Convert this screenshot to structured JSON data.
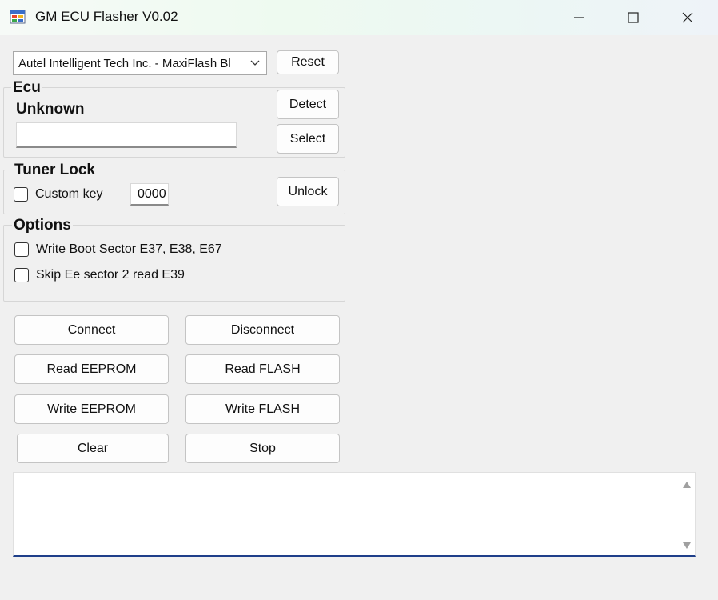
{
  "window": {
    "title": "GM ECU Flasher V0.02"
  },
  "device": {
    "selected": "Autel Intelligent Tech Inc. - MaxiFlash Bl",
    "reset_label": "Reset"
  },
  "ecu": {
    "group_title": "Ecu",
    "status": "Unknown",
    "input_value": "",
    "detect_label": "Detect",
    "select_label": "Select"
  },
  "tuner_lock": {
    "group_title": "Tuner Lock",
    "custom_key_label": "Custom key",
    "key_value": "0000",
    "unlock_label": "Unlock"
  },
  "options": {
    "group_title": "Options",
    "items": [
      {
        "label": "Write Boot Sector E37, E38, E67",
        "checked": false
      },
      {
        "label": "Skip Ee sector 2 read E39",
        "checked": false
      }
    ]
  },
  "actions": {
    "connect": "Connect",
    "disconnect": "Disconnect",
    "read_eeprom": "Read  EEPROM",
    "read_flash": "Read  FLASH",
    "write_eeprom": "Write  EEPROM",
    "write_flash": "Write  FLASH",
    "clear": "Clear",
    "stop": "Stop"
  },
  "log": {
    "text": ""
  },
  "colors": {
    "accent_underline": "#1f3f8a",
    "window_bg": "#f0f0f0"
  }
}
